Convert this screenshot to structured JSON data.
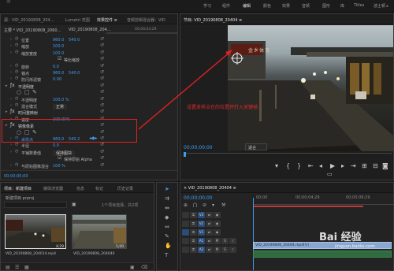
{
  "workspaces": {
    "items": [
      "学习",
      "组件",
      "编辑",
      "颜色",
      "效果",
      "音频",
      "图形",
      "库",
      "Titles",
      "波士顿 ▸"
    ],
    "active_index": 2
  },
  "effect_controls": {
    "tabs": [
      "源：VID_20190808_204...",
      "Lumetri 范围",
      "效果控件 ≡",
      "音频剪辑混合器：VID"
    ],
    "active_tab_index": 2,
    "header": "主要 * VID_20190808_2060...",
    "header2": "VID_20190808_204...",
    "ruler_time": "00;00;04;29",
    "rows": [
      {
        "label": "位置",
        "v1": "960.0",
        "v2": "540.0",
        "indent": 1
      },
      {
        "label": "缩放",
        "v1": "100.0",
        "v2": "",
        "indent": 1
      },
      {
        "label": "缩放宽度",
        "v1": "100.0",
        "v2": "",
        "indent": 1
      },
      {
        "label": "等比缩放",
        "v1": "",
        "v2": "",
        "indent": 2,
        "checkbox": true
      },
      {
        "label": "旋转",
        "v1": "0.0",
        "v2": "",
        "indent": 1
      },
      {
        "label": "锚点",
        "v1": "960.0",
        "v2": "540.0",
        "indent": 1
      },
      {
        "label": "防闪烁滤镜",
        "v1": "0.00",
        "v2": "",
        "indent": 1
      },
      {
        "label": "不透明度",
        "v1": "",
        "v2": "",
        "indent": 0,
        "section": true
      },
      {
        "label": "",
        "v1": "",
        "v2": "",
        "indent": 1,
        "shapes": true
      },
      {
        "label": "不透明度",
        "v1": "100.0 %",
        "v2": "",
        "indent": 1
      },
      {
        "label": "混合模式",
        "v1": "正常",
        "v2": "",
        "indent": 1,
        "dropdown": true
      },
      {
        "label": "时间重映射",
        "v1": "",
        "v2": "",
        "indent": 0,
        "section": true
      },
      {
        "label": "速度",
        "v1": "100.00%",
        "v2": "",
        "indent": 1
      },
      {
        "label": "镜像像素",
        "v1": "",
        "v2": "",
        "indent": 0,
        "section": true,
        "highlight": true
      },
      {
        "label": "",
        "v1": "",
        "v2": "",
        "indent": 1,
        "shapes": true
      },
      {
        "label": "采样点",
        "v1": "960.0",
        "v2": "540.2",
        "indent": 1,
        "blue_label": true
      },
      {
        "label": "半径",
        "v1": "0.0",
        "v2": "",
        "indent": 1
      },
      {
        "label": "平铺数量值",
        "v1": "保持图块",
        "v2": "",
        "indent": 1,
        "dropdown": true
      },
      {
        "label": "",
        "v1": "",
        "v2": "",
        "indent": 2,
        "checkbox2": true,
        "text": "保持原始 Alpha"
      },
      {
        "label": "与原始图像混合",
        "v1": "100 %",
        "v2": "",
        "indent": 1
      }
    ],
    "timecode": "00;00;00;00"
  },
  "program_monitor": {
    "tab": "节目: VID_20190808_20404 ≡",
    "timecode": "00;00;00;00",
    "fit_label": "适合",
    "annotation": "设置采样点在的位置并打入关键帧",
    "sign_text": "金乡体育"
  },
  "project": {
    "tabs": [
      "项目：新建项目",
      "媒体浏览器",
      "信息",
      "标记",
      "历史记录"
    ],
    "active_tab_index": 0,
    "file_name": "新建项目.prproj",
    "selected_info": "1个项目选择，共2项",
    "clips": [
      {
        "name": "VID_20190808_204014.mp4",
        "duration": "4;29"
      },
      {
        "name": "VID_20190808_204040",
        "duration": "5;00"
      }
    ]
  },
  "timeline": {
    "tab": "× VID_20190808_20404 ≡",
    "timecode": "00;00;00;00",
    "ruler": [
      "00;00",
      "00;00;04;29",
      "00;00;09;29"
    ],
    "video_tracks": [
      "V3",
      "V2",
      "V1"
    ],
    "audio_tracks": [
      "A1",
      "A2"
    ],
    "clip_name": "VID_20190808_20404.mp4[V]",
    "watermark_main": "Bai 经验",
    "watermark_sub": "jingyan.baidu.com"
  }
}
